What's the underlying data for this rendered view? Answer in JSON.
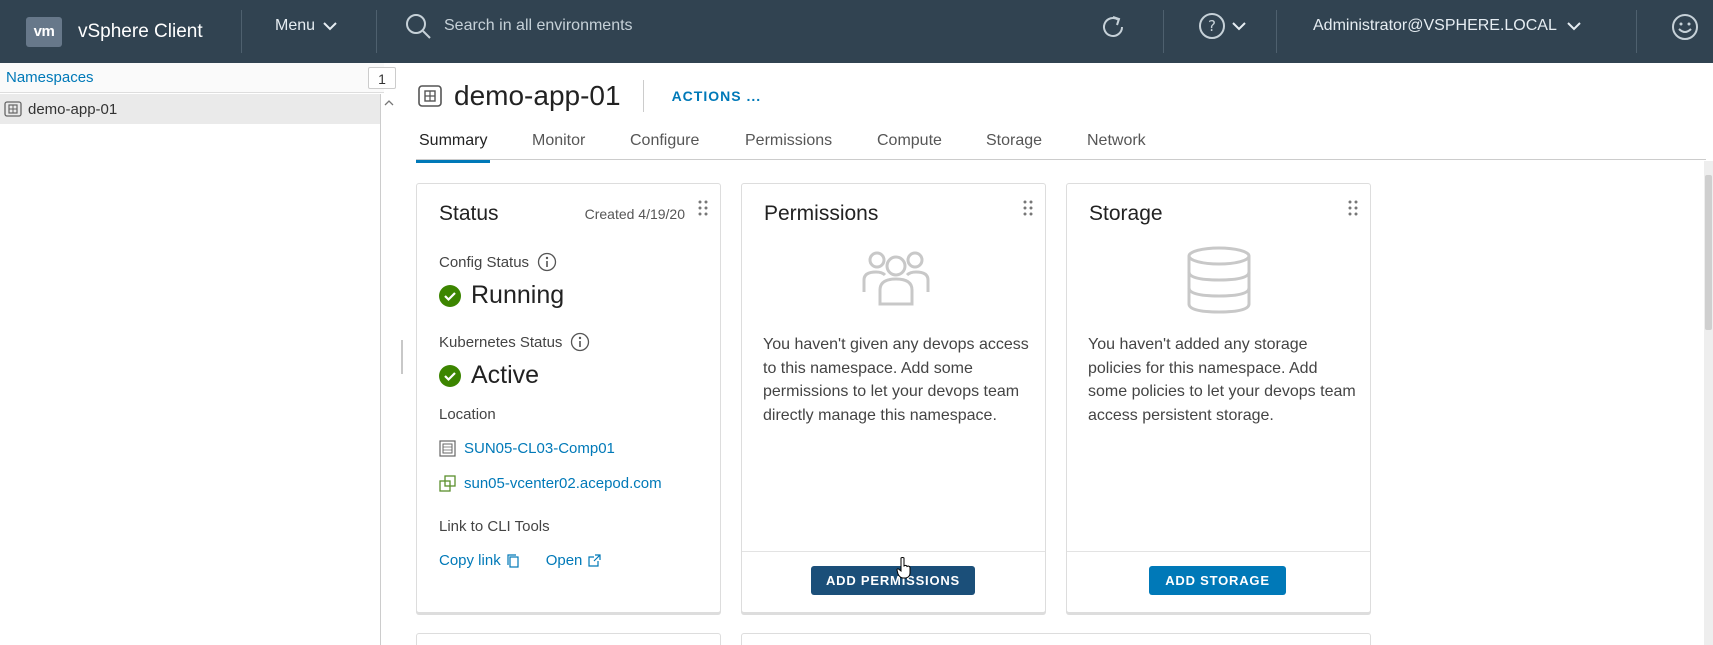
{
  "header": {
    "logo": "vm",
    "app_title": "vSphere Client",
    "menu_label": "Menu",
    "search_placeholder": "Search in all environments",
    "user_label": "Administrator@VSPHERE.LOCAL",
    "icons": [
      "search-icon",
      "refresh-icon",
      "help-icon",
      "chevron-down-icon",
      "smiley-icon"
    ]
  },
  "sidebar": {
    "title": "Namespaces",
    "count": "1",
    "items": [
      {
        "label": "demo-app-01",
        "icon": "namespace-icon",
        "selected": true
      }
    ]
  },
  "object": {
    "title": "demo-app-01",
    "actions_label": "ACTIONS ..."
  },
  "tabs": [
    {
      "label": "Summary",
      "active": true
    },
    {
      "label": "Monitor",
      "active": false
    },
    {
      "label": "Configure",
      "active": false
    },
    {
      "label": "Permissions",
      "active": false
    },
    {
      "label": "Compute",
      "active": false
    },
    {
      "label": "Storage",
      "active": false
    },
    {
      "label": "Network",
      "active": false
    }
  ],
  "status_card": {
    "title": "Status",
    "created": "Created 4/19/20",
    "config_status_label": "Config Status",
    "config_status_value": "Running",
    "k8s_status_label": "Kubernetes Status",
    "k8s_status_value": "Active",
    "location_label": "Location",
    "location_cluster": "SUN05-CL03-Comp01",
    "location_vcenter": "sun05-vcenter02.acepod.com",
    "cli_label": "Link to CLI Tools",
    "copy_link": "Copy link",
    "open_link": "Open",
    "status_color": "#3c8500"
  },
  "permissions_card": {
    "title": "Permissions",
    "empty_text": "You haven't given any devops access to this namespace. Add some permissions to let your devops team directly manage this namespace.",
    "button_label": "ADD PERMISSIONS"
  },
  "storage_card": {
    "title": "Storage",
    "empty_text": "You haven't added any storage policies for this namespace. Add some policies to let your devops team access persistent storage.",
    "button_label": "ADD STORAGE"
  },
  "colors": {
    "header_bg": "#314351",
    "accent": "#0079b8",
    "button_pressed": "#1b4f79"
  }
}
